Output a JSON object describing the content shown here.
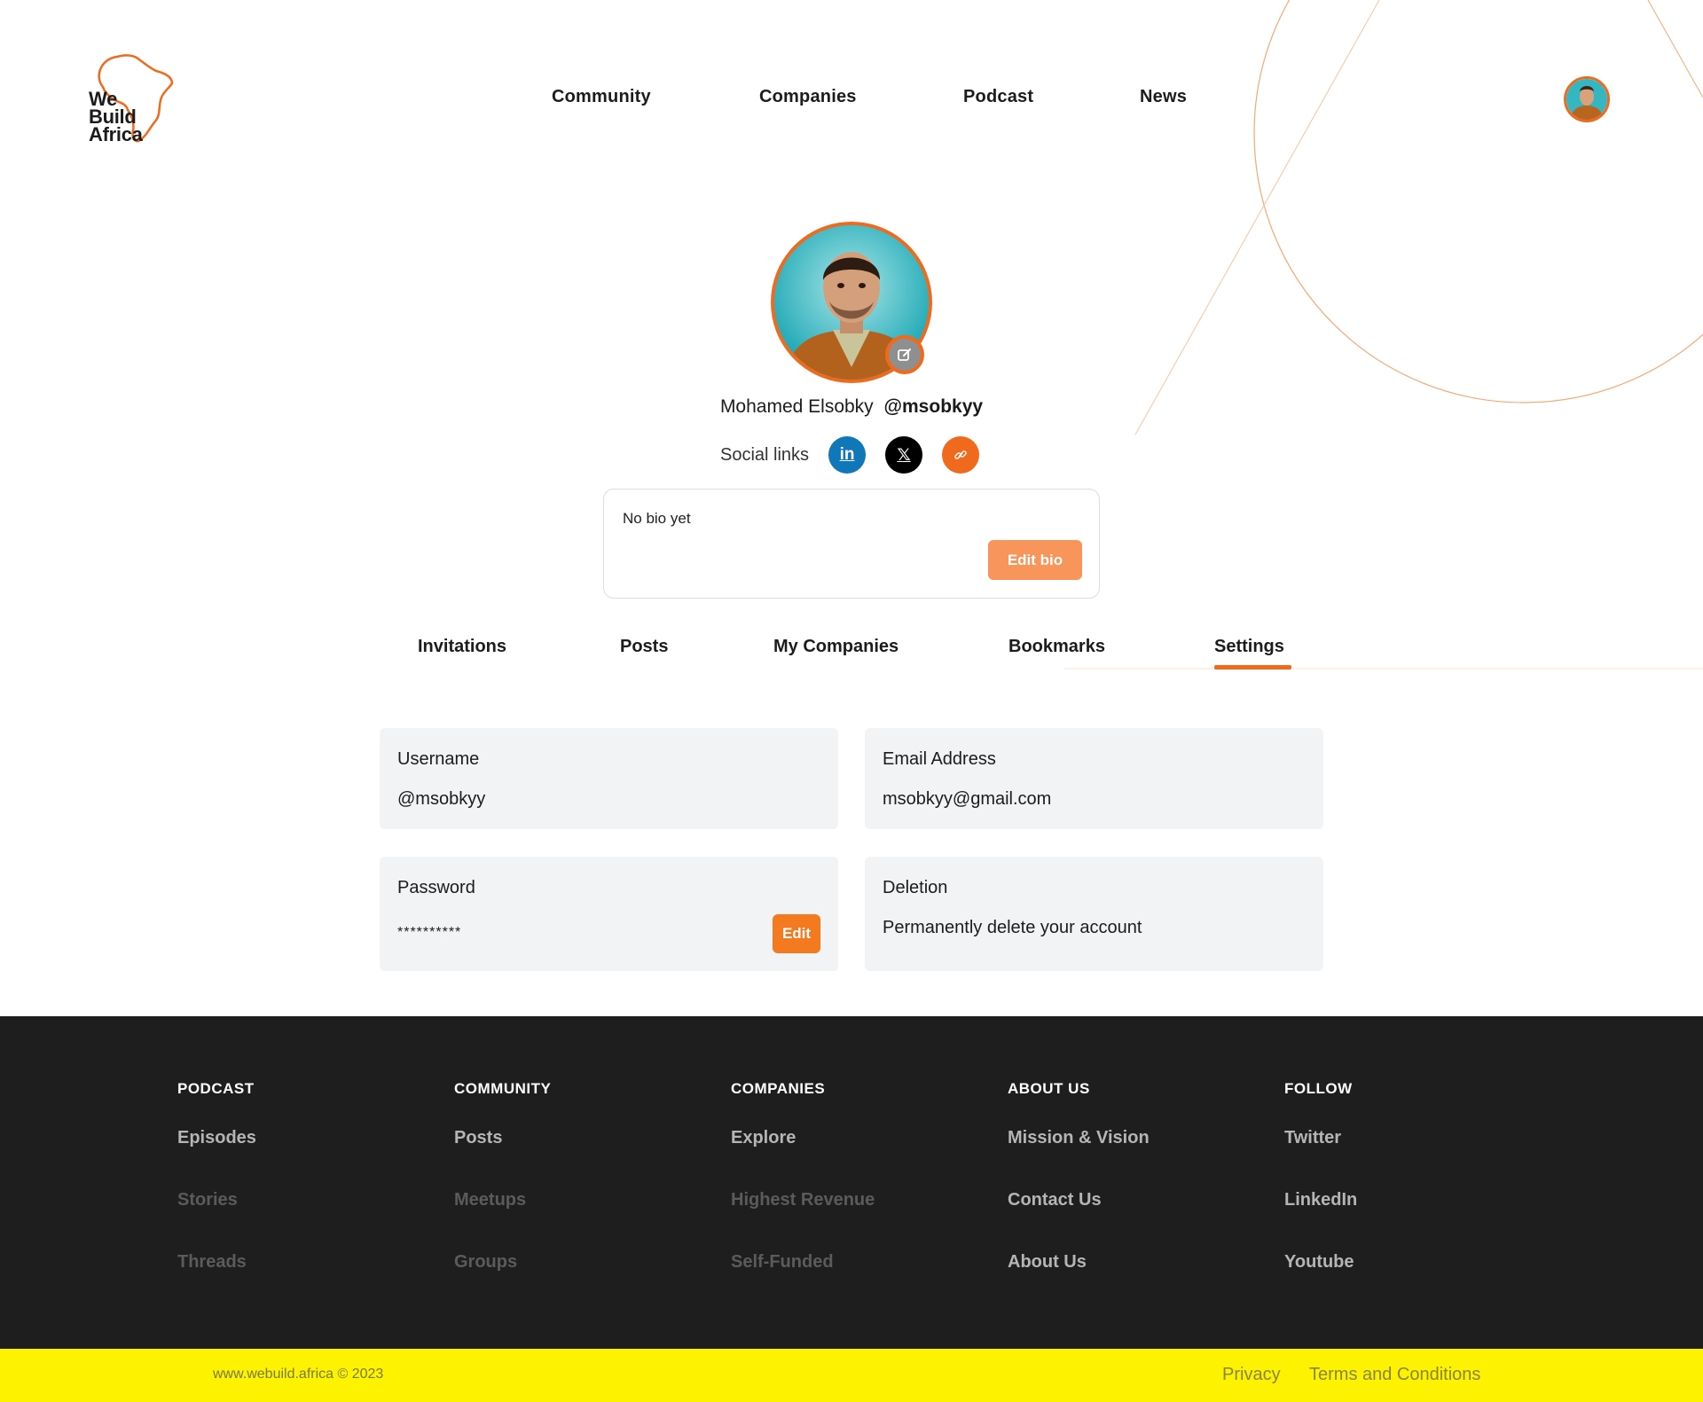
{
  "header": {
    "logo_lines": [
      "We",
      "Build",
      "Africa"
    ],
    "nav": [
      {
        "label": "Community"
      },
      {
        "label": "Companies"
      },
      {
        "label": "Podcast"
      },
      {
        "label": "News"
      }
    ]
  },
  "profile": {
    "full_name": "Mohamed Elsobky",
    "handle": "@msobkyy",
    "social_label": "Social links",
    "social_icons": [
      "linkedin-icon",
      "x-icon",
      "link-icon"
    ],
    "social_glyphs": {
      "linkedin": "in",
      "x": "𝕏"
    },
    "bio": "No bio yet",
    "edit_bio_label": "Edit bio"
  },
  "tabs": [
    {
      "label": "Invitations",
      "active": false
    },
    {
      "label": "Posts",
      "active": false
    },
    {
      "label": "My Companies",
      "active": false
    },
    {
      "label": "Bookmarks",
      "active": false
    },
    {
      "label": "Settings",
      "active": true
    }
  ],
  "settings": {
    "username": {
      "label": "Username",
      "value": "@msobkyy"
    },
    "email": {
      "label": "Email Address",
      "value": "msobkyy@gmail.com"
    },
    "password": {
      "label": "Password",
      "value": "**********",
      "edit_label": "Edit"
    },
    "deletion": {
      "label": "Deletion",
      "value": "Permanently delete your account"
    }
  },
  "footer": {
    "columns": [
      {
        "heading": "PODCAST",
        "links": [
          "Episodes",
          "Stories",
          "Threads"
        ]
      },
      {
        "heading": "COMMUNITY",
        "links": [
          "Posts",
          "Meetups",
          "Groups"
        ]
      },
      {
        "heading": "COMPANIES",
        "links": [
          "Explore",
          "Highest Revenue",
          "Self-Funded"
        ]
      },
      {
        "heading": "ABOUT US",
        "links": [
          "Mission & Vision",
          "Contact Us",
          "About Us"
        ]
      },
      {
        "heading": "FOLLOW",
        "links": [
          "Twitter",
          "LinkedIn",
          "Youtube"
        ]
      }
    ],
    "copyright": "www.webuild.africa © 2023",
    "privacy": "Privacy",
    "terms": "Terms and Conditions"
  },
  "colors": {
    "accent": "#f06a1d",
    "accent_light": "#f7955a",
    "footer_bg": "#1e1e1e",
    "bottom_bar": "#fdf200",
    "card_bg": "#f2f3f5",
    "linkedin": "#1077b8",
    "link_active": "#b5b5b5",
    "link_muted": "#5b5b5b"
  }
}
